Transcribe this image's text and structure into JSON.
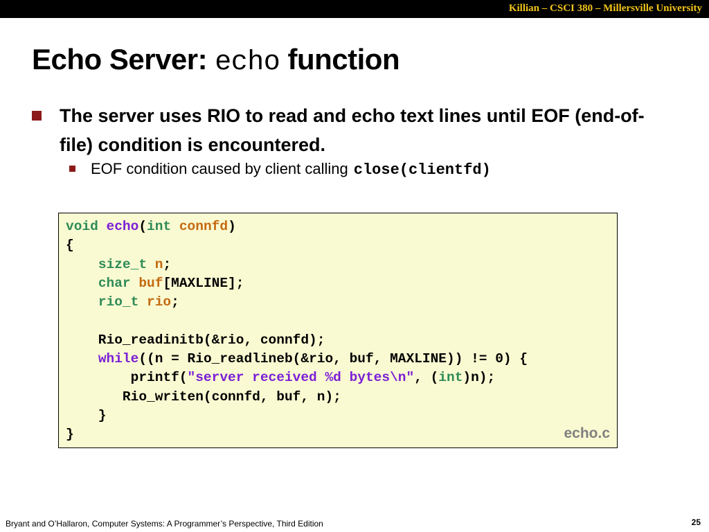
{
  "header": {
    "text": "Killian – CSCI 380 – Millersville University"
  },
  "title": {
    "prefix": "Echo Server: ",
    "code": "echo",
    "suffix": " function"
  },
  "bullets": {
    "main": "The server uses RIO to read and echo text lines until EOF (end-of-file) condition is encountered.",
    "sub_text": "EOF condition caused by client calling",
    "sub_code": "close(clientfd)"
  },
  "code": {
    "line1": {
      "kw1": "void",
      "fn": "echo",
      "open": "(",
      "kw2": "int",
      "param": "connfd",
      "close": ")"
    },
    "line2": "{",
    "line3": {
      "indent": "    ",
      "kw": "size_t",
      "sp": " ",
      "var": "n",
      "end": ";"
    },
    "line4": {
      "indent": "    ",
      "kw": "char",
      "sp": " ",
      "var": "buf",
      "end": "[MAXLINE];"
    },
    "line5": {
      "indent": "    ",
      "kw": "rio_t",
      "sp": " ",
      "var": "rio",
      "end": ";"
    },
    "line6": "",
    "line7": "    Rio_readinitb(&rio, connfd);",
    "line8": {
      "indent": "    ",
      "kw": "while",
      "rest": "((n = Rio_readlineb(&rio, buf, MAXLINE)) != 0) {"
    },
    "line9": {
      "indent": "        printf(",
      "str": "\"server received %d bytes\\n\"",
      "mid": ", (",
      "kw": "int",
      "end": ")n);"
    },
    "line10": "       Rio_writen(connfd, buf, n);",
    "line11": "    }",
    "line12": "}"
  },
  "filename": "echo.c",
  "footer": {
    "citation": "Bryant and O’Hallaron, Computer Systems: A Programmer’s Perspective, Third Edition",
    "page": "25"
  },
  "colors": {
    "header_bg": "#000000",
    "header_text": "#f0c419",
    "bullet_marker": "#8b1a1a",
    "code_bg": "#fafad2",
    "keyword": "#2e8b57",
    "function": "#7b1fd6",
    "variable": "#c46a10"
  }
}
